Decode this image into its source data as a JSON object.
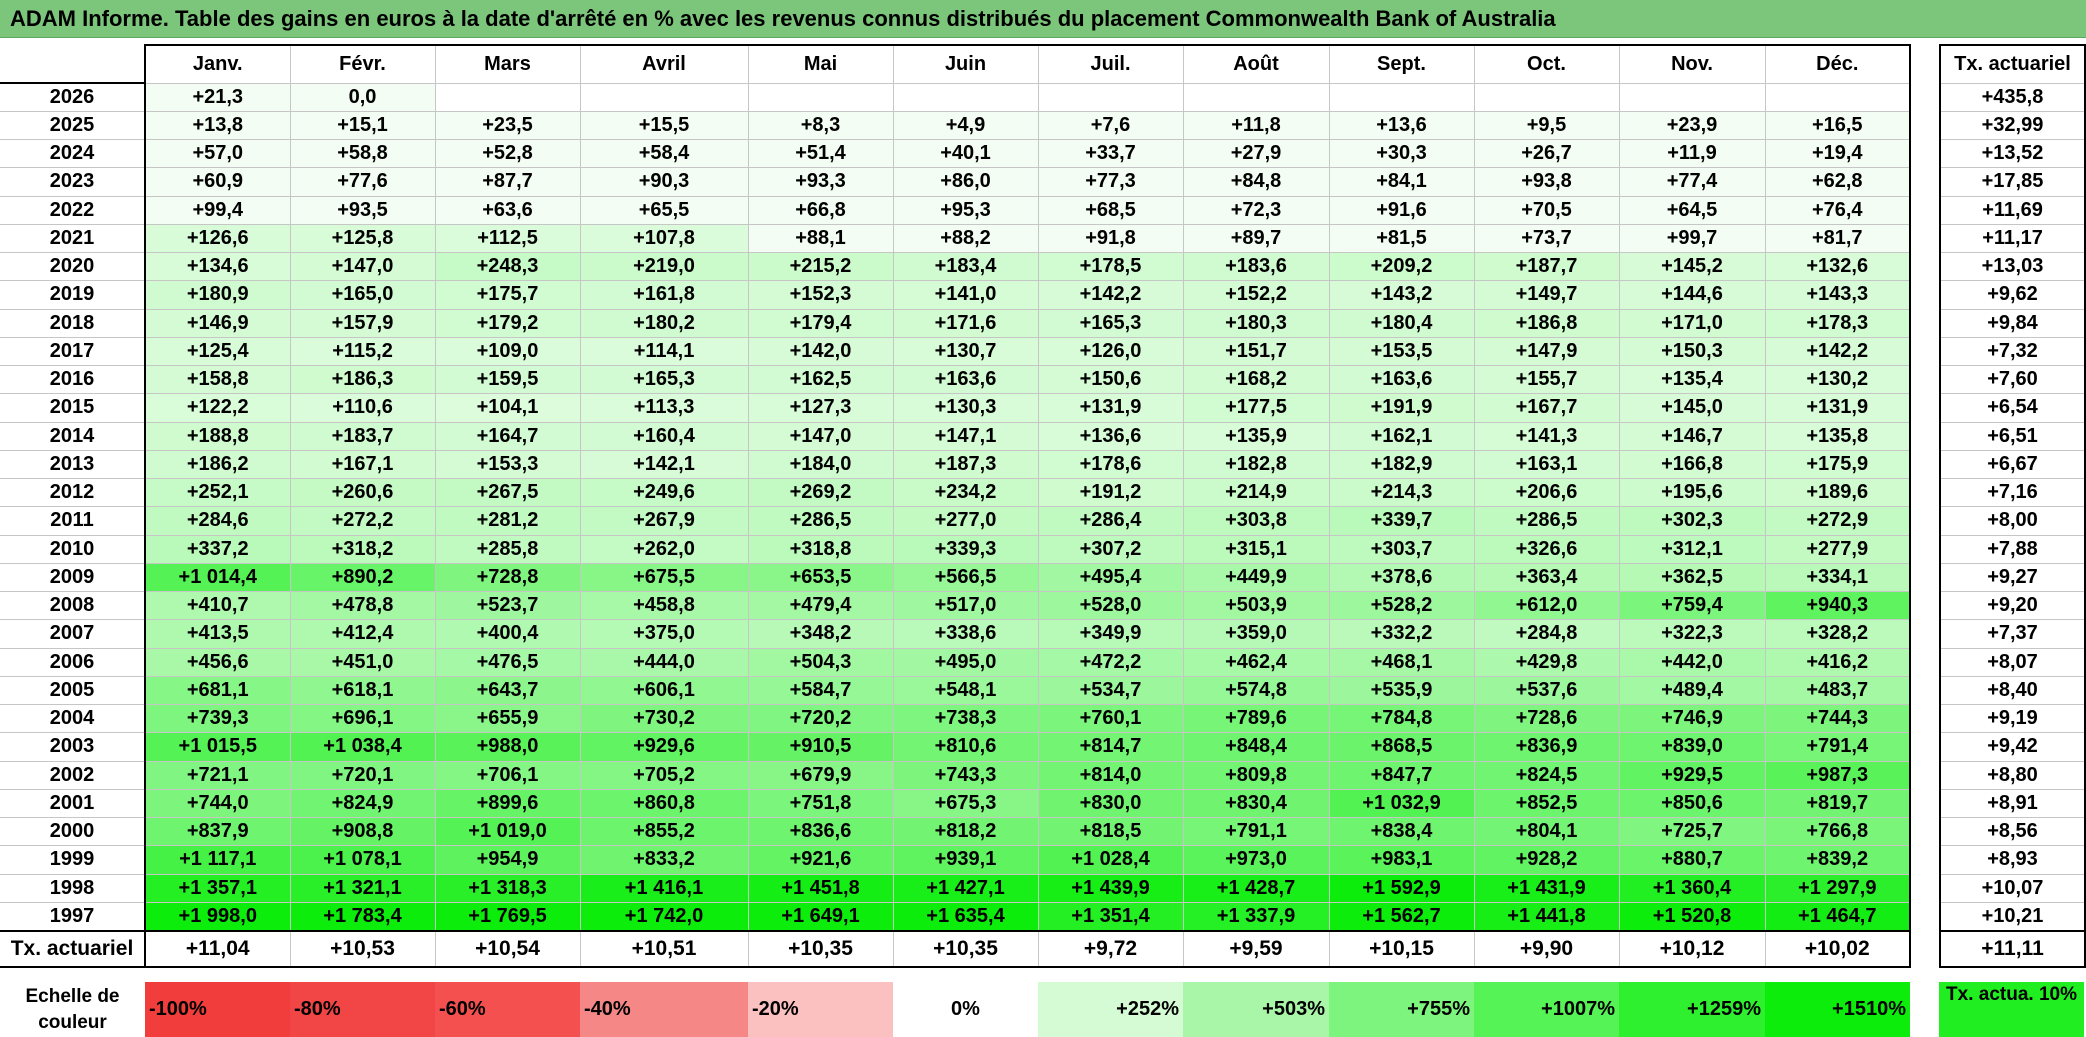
{
  "title": "ADAM Informe. Table des gains en euros à la date d'arrêté en % avec les revenus connus distribués du placement Commonwealth Bank of Australia",
  "months": [
    "Janv.",
    "Févr.",
    "Mars",
    "Avril",
    "Mai",
    "Juin",
    "Juil.",
    "Août",
    "Sept.",
    "Oct.",
    "Nov.",
    "Déc."
  ],
  "actuarial_header": "Tx. actuariel",
  "rows": [
    {
      "year": "2026",
      "values": [
        "+21,3",
        "0,0",
        "",
        "",
        "",
        "",
        "",
        "",
        "",
        "",
        "",
        ""
      ],
      "actuarial": "+435,8"
    },
    {
      "year": "2025",
      "values": [
        "+13,8",
        "+15,1",
        "+23,5",
        "+15,5",
        "+8,3",
        "+4,9",
        "+7,6",
        "+11,8",
        "+13,6",
        "+9,5",
        "+23,9",
        "+16,5"
      ],
      "actuarial": "+32,99"
    },
    {
      "year": "2024",
      "values": [
        "+57,0",
        "+58,8",
        "+52,8",
        "+58,4",
        "+51,4",
        "+40,1",
        "+33,7",
        "+27,9",
        "+30,3",
        "+26,7",
        "+11,9",
        "+19,4"
      ],
      "actuarial": "+13,52"
    },
    {
      "year": "2023",
      "values": [
        "+60,9",
        "+77,6",
        "+87,7",
        "+90,3",
        "+93,3",
        "+86,0",
        "+77,3",
        "+84,8",
        "+84,1",
        "+93,8",
        "+77,4",
        "+62,8"
      ],
      "actuarial": "+17,85"
    },
    {
      "year": "2022",
      "values": [
        "+99,4",
        "+93,5",
        "+63,6",
        "+65,5",
        "+66,8",
        "+95,3",
        "+68,5",
        "+72,3",
        "+91,6",
        "+70,5",
        "+64,5",
        "+76,4"
      ],
      "actuarial": "+11,69"
    },
    {
      "year": "2021",
      "values": [
        "+126,6",
        "+125,8",
        "+112,5",
        "+107,8",
        "+88,1",
        "+88,2",
        "+91,8",
        "+89,7",
        "+81,5",
        "+73,7",
        "+99,7",
        "+81,7"
      ],
      "actuarial": "+11,17"
    },
    {
      "year": "2020",
      "values": [
        "+134,6",
        "+147,0",
        "+248,3",
        "+219,0",
        "+215,2",
        "+183,4",
        "+178,5",
        "+183,6",
        "+209,2",
        "+187,7",
        "+145,2",
        "+132,6"
      ],
      "actuarial": "+13,03"
    },
    {
      "year": "2019",
      "values": [
        "+180,9",
        "+165,0",
        "+175,7",
        "+161,8",
        "+152,3",
        "+141,0",
        "+142,2",
        "+152,2",
        "+143,2",
        "+149,7",
        "+144,6",
        "+143,3"
      ],
      "actuarial": "+9,62"
    },
    {
      "year": "2018",
      "values": [
        "+146,9",
        "+157,9",
        "+179,2",
        "+180,2",
        "+179,4",
        "+171,6",
        "+165,3",
        "+180,3",
        "+180,4",
        "+186,8",
        "+171,0",
        "+178,3"
      ],
      "actuarial": "+9,84"
    },
    {
      "year": "2017",
      "values": [
        "+125,4",
        "+115,2",
        "+109,0",
        "+114,1",
        "+142,0",
        "+130,7",
        "+126,0",
        "+151,7",
        "+153,5",
        "+147,9",
        "+150,3",
        "+142,2"
      ],
      "actuarial": "+7,32"
    },
    {
      "year": "2016",
      "values": [
        "+158,8",
        "+186,3",
        "+159,5",
        "+165,3",
        "+162,5",
        "+163,6",
        "+150,6",
        "+168,2",
        "+163,6",
        "+155,7",
        "+135,4",
        "+130,2"
      ],
      "actuarial": "+7,60"
    },
    {
      "year": "2015",
      "values": [
        "+122,2",
        "+110,6",
        "+104,1",
        "+113,3",
        "+127,3",
        "+130,3",
        "+131,9",
        "+177,5",
        "+191,9",
        "+167,7",
        "+145,0",
        "+131,9"
      ],
      "actuarial": "+6,54"
    },
    {
      "year": "2014",
      "values": [
        "+188,8",
        "+183,7",
        "+164,7",
        "+160,4",
        "+147,0",
        "+147,1",
        "+136,6",
        "+135,9",
        "+162,1",
        "+141,3",
        "+146,7",
        "+135,8"
      ],
      "actuarial": "+6,51"
    },
    {
      "year": "2013",
      "values": [
        "+186,2",
        "+167,1",
        "+153,3",
        "+142,1",
        "+184,0",
        "+187,3",
        "+178,6",
        "+182,8",
        "+182,9",
        "+163,1",
        "+166,8",
        "+175,9"
      ],
      "actuarial": "+6,67"
    },
    {
      "year": "2012",
      "values": [
        "+252,1",
        "+260,6",
        "+267,5",
        "+249,6",
        "+269,2",
        "+234,2",
        "+191,2",
        "+214,9",
        "+214,3",
        "+206,6",
        "+195,6",
        "+189,6"
      ],
      "actuarial": "+7,16"
    },
    {
      "year": "2011",
      "values": [
        "+284,6",
        "+272,2",
        "+281,2",
        "+267,9",
        "+286,5",
        "+277,0",
        "+286,4",
        "+303,8",
        "+339,7",
        "+286,5",
        "+302,3",
        "+272,9"
      ],
      "actuarial": "+8,00"
    },
    {
      "year": "2010",
      "values": [
        "+337,2",
        "+318,2",
        "+285,8",
        "+262,0",
        "+318,8",
        "+339,3",
        "+307,2",
        "+315,1",
        "+303,7",
        "+326,6",
        "+312,1",
        "+277,9"
      ],
      "actuarial": "+7,88"
    },
    {
      "year": "2009",
      "values": [
        "+1 014,4",
        "+890,2",
        "+728,8",
        "+675,5",
        "+653,5",
        "+566,5",
        "+495,4",
        "+449,9",
        "+378,6",
        "+363,4",
        "+362,5",
        "+334,1"
      ],
      "actuarial": "+9,27"
    },
    {
      "year": "2008",
      "values": [
        "+410,7",
        "+478,8",
        "+523,7",
        "+458,8",
        "+479,4",
        "+517,0",
        "+528,0",
        "+503,9",
        "+528,2",
        "+612,0",
        "+759,4",
        "+940,3"
      ],
      "actuarial": "+9,20"
    },
    {
      "year": "2007",
      "values": [
        "+413,5",
        "+412,4",
        "+400,4",
        "+375,0",
        "+348,2",
        "+338,6",
        "+349,9",
        "+359,0",
        "+332,2",
        "+284,8",
        "+322,3",
        "+328,2"
      ],
      "actuarial": "+7,37"
    },
    {
      "year": "2006",
      "values": [
        "+456,6",
        "+451,0",
        "+476,5",
        "+444,0",
        "+504,3",
        "+495,0",
        "+472,2",
        "+462,4",
        "+468,1",
        "+429,8",
        "+442,0",
        "+416,2"
      ],
      "actuarial": "+8,07"
    },
    {
      "year": "2005",
      "values": [
        "+681,1",
        "+618,1",
        "+643,7",
        "+606,1",
        "+584,7",
        "+548,1",
        "+534,7",
        "+574,8",
        "+535,9",
        "+537,6",
        "+489,4",
        "+483,7"
      ],
      "actuarial": "+8,40"
    },
    {
      "year": "2004",
      "values": [
        "+739,3",
        "+696,1",
        "+655,9",
        "+730,2",
        "+720,2",
        "+738,3",
        "+760,1",
        "+789,6",
        "+784,8",
        "+728,6",
        "+746,9",
        "+744,3"
      ],
      "actuarial": "+9,19"
    },
    {
      "year": "2003",
      "values": [
        "+1 015,5",
        "+1 038,4",
        "+988,0",
        "+929,6",
        "+910,5",
        "+810,6",
        "+814,7",
        "+848,4",
        "+868,5",
        "+836,9",
        "+839,0",
        "+791,4"
      ],
      "actuarial": "+9,42"
    },
    {
      "year": "2002",
      "values": [
        "+721,1",
        "+720,1",
        "+706,1",
        "+705,2",
        "+679,9",
        "+743,3",
        "+814,0",
        "+809,8",
        "+847,7",
        "+824,5",
        "+929,5",
        "+987,3"
      ],
      "actuarial": "+8,80"
    },
    {
      "year": "2001",
      "values": [
        "+744,0",
        "+824,9",
        "+899,6",
        "+860,8",
        "+751,8",
        "+675,3",
        "+830,0",
        "+830,4",
        "+1 032,9",
        "+852,5",
        "+850,6",
        "+819,7"
      ],
      "actuarial": "+8,91"
    },
    {
      "year": "2000",
      "values": [
        "+837,9",
        "+908,8",
        "+1 019,0",
        "+855,2",
        "+836,6",
        "+818,2",
        "+818,5",
        "+791,1",
        "+838,4",
        "+804,1",
        "+725,7",
        "+766,8"
      ],
      "actuarial": "+8,56"
    },
    {
      "year": "1999",
      "values": [
        "+1 117,1",
        "+1 078,1",
        "+954,9",
        "+833,2",
        "+921,6",
        "+939,1",
        "+1 028,4",
        "+973,0",
        "+983,1",
        "+928,2",
        "+880,7",
        "+839,2"
      ],
      "actuarial": "+8,93"
    },
    {
      "year": "1998",
      "values": [
        "+1 357,1",
        "+1 321,1",
        "+1 318,3",
        "+1 416,1",
        "+1 451,8",
        "+1 427,1",
        "+1 439,9",
        "+1 428,7",
        "+1 592,9",
        "+1 431,9",
        "+1 360,4",
        "+1 297,9"
      ],
      "actuarial": "+10,07"
    },
    {
      "year": "1997",
      "values": [
        "+1 998,0",
        "+1 783,4",
        "+1 769,5",
        "+1 742,0",
        "+1 649,1",
        "+1 635,4",
        "+1 351,4",
        "+1 337,9",
        "+1 562,7",
        "+1 441,8",
        "+1 520,8",
        "+1 464,7"
      ],
      "actuarial": "+10,21"
    }
  ],
  "totals": {
    "label": "Tx. actuariel",
    "values": [
      "+11,04",
      "+10,53",
      "+10,54",
      "+10,51",
      "+10,35",
      "+10,35",
      "+9,72",
      "+9,59",
      "+10,15",
      "+9,90",
      "+10,12",
      "+10,02"
    ],
    "actuarial": "+11,11"
  },
  "scale": {
    "label": "Echelle de couleur",
    "items": [
      {
        "label": "-100%",
        "color": "#f23d3d"
      },
      {
        "label": "-80%",
        "color": "#f24545"
      },
      {
        "label": "-60%",
        "color": "#f45050"
      },
      {
        "label": "-40%",
        "color": "#f58787"
      },
      {
        "label": "-20%",
        "color": "#fbc1c1"
      },
      {
        "label": "0%",
        "color": "#ffffff"
      },
      {
        "label": "+252%",
        "color": "#d5fbd5"
      },
      {
        "label": "+503%",
        "color": "#a9f6a9"
      },
      {
        "label": "+755%",
        "color": "#7df47d"
      },
      {
        "label": "+1007%",
        "color": "#56f356"
      },
      {
        "label": "+1259%",
        "color": "#2ef02e"
      },
      {
        "label": "+1510%",
        "color": "#0ced0c"
      }
    ],
    "legend": "Tx. actua. 10%",
    "legend_color": "#20ee20"
  },
  "colors": {
    "title_bar": "#7cc67c",
    "cell_base": "#ffffff",
    "cell_scale_max": "#0aea0a",
    "actuarial_cell": "#ffffff"
  }
}
